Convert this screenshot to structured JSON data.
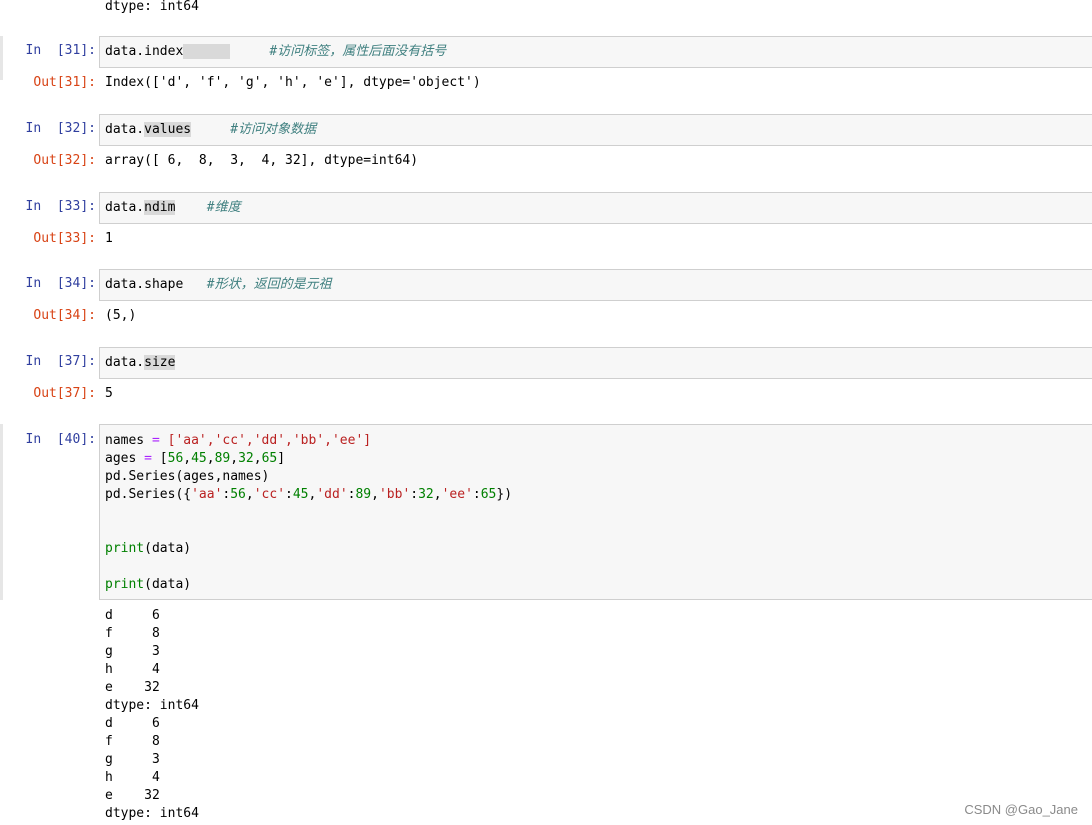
{
  "top_output": "dtype: int64",
  "cells": [
    {
      "in_prompt": "In  [31]:",
      "out_prompt": "Out[31]:",
      "code_pre": "data.index",
      "code_hl": "      ",
      "comment": "#访问标签，属性后面没有括号",
      "output": "Index(['d', 'f', 'g', 'h', 'e'], dtype='object')"
    },
    {
      "in_prompt": "In  [32]:",
      "out_prompt": "Out[32]:",
      "code_pre": "data.",
      "code_hl": "values",
      "comment": "#访问对象数据",
      "output": "array([ 6,  8,  3,  4, 32], dtype=int64)"
    },
    {
      "in_prompt": "In  [33]:",
      "out_prompt": "Out[33]:",
      "code_pre": "data.",
      "code_hl": "ndim",
      "comment": "#维度",
      "output": "1"
    },
    {
      "in_prompt": "In  [34]:",
      "out_prompt": "Out[34]:",
      "code_pre": "data.shape",
      "code_hl": "",
      "comment": "#形状，返回的是元祖",
      "output": "(5,)"
    },
    {
      "in_prompt": "In  [37]:",
      "out_prompt": "Out[37]:",
      "code_pre": "data.",
      "code_hl": "size",
      "comment": "",
      "output": "5"
    }
  ],
  "cell40": {
    "in_prompt": "In  [40]:",
    "line1": {
      "var": "names",
      "op": "=",
      "val": "['aa','cc','dd','bb','ee']"
    },
    "line2": {
      "var": "ages",
      "op": "=",
      "nums": [
        "56",
        "45",
        "89",
        "32",
        "65"
      ]
    },
    "line3": "pd.Series(ages,names)",
    "line4_pre": "pd.Series({",
    "line4_pairs": [
      {
        "k": "'aa'",
        "v": "56"
      },
      {
        "k": "'cc'",
        "v": "45"
      },
      {
        "k": "'dd'",
        "v": "89"
      },
      {
        "k": "'bb'",
        "v": "32"
      },
      {
        "k": "'ee'",
        "v": "65"
      }
    ],
    "line4_post": "})",
    "print_fn": "print",
    "print_arg": "(data)",
    "output_lines": [
      "d     6",
      "f     8",
      "g     3",
      "h     4",
      "e    32",
      "dtype: int64",
      "d     6",
      "f     8",
      "g     3",
      "h     4",
      "e    32",
      "dtype: int64"
    ]
  },
  "watermark": "CSDN @Gao_Jane"
}
